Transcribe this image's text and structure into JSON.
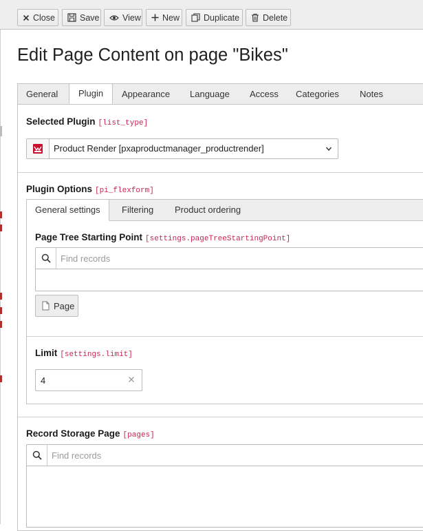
{
  "toolbar": {
    "close_label": "Close",
    "save_label": "Save",
    "view_label": "View",
    "new_label": "New",
    "duplicate_label": "Duplicate",
    "delete_label": "Delete"
  },
  "page_title": "Edit Page Content on page \"Bikes\"",
  "tabs": [
    {
      "label": "General",
      "active": false
    },
    {
      "label": "Plugin",
      "active": true
    },
    {
      "label": "Appearance",
      "active": false
    },
    {
      "label": "Language",
      "active": false
    },
    {
      "label": "Access",
      "active": false
    },
    {
      "label": "Categories",
      "active": false
    },
    {
      "label": "Notes",
      "active": false
    }
  ],
  "selected_plugin": {
    "label": "Selected Plugin",
    "field": "[list_type]",
    "value": "Product Render [pxaproductmanager_productrender]",
    "icon": "plugin-icon"
  },
  "plugin_options": {
    "label": "Plugin Options",
    "field": "[pi_flexform]",
    "subtabs": [
      {
        "label": "General settings",
        "active": true
      },
      {
        "label": "Filtering",
        "active": false
      },
      {
        "label": "Product ordering",
        "active": false
      }
    ],
    "starting_point": {
      "label": "Page Tree Starting Point",
      "field": "[settings.pageTreeStartingPoint]",
      "placeholder": "Find records",
      "page_button_label": "Page"
    },
    "limit": {
      "label": "Limit",
      "field": "[settings.limit]",
      "value": "4"
    }
  },
  "record_storage": {
    "label": "Record Storage Page",
    "field": "[pages]",
    "placeholder": "Find records"
  },
  "colors": {
    "accent_red": "#c7254e",
    "plugin_icon_red": "#c8102e",
    "toolbar_bg": "#eeeeee"
  }
}
